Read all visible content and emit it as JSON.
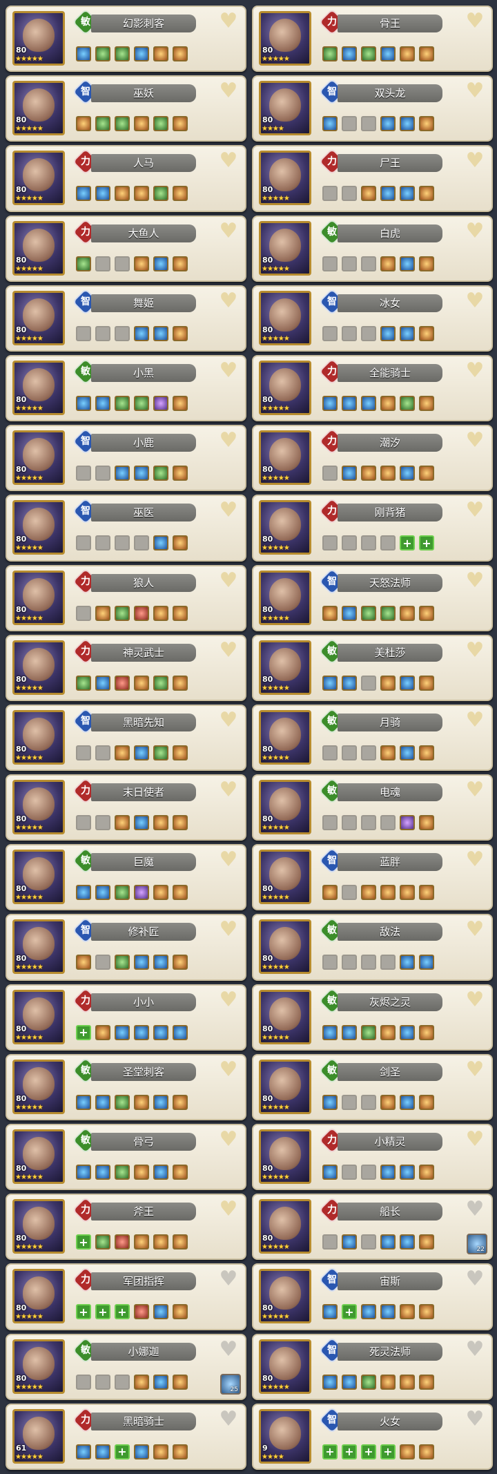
{
  "icons": {
    "heart": "heart-icon",
    "star": "star-icon",
    "item_slot": "item-slot-icon",
    "add": "plus-icon"
  },
  "colors": {
    "attr_strength": "#b02a2a",
    "attr_intelligence": "#2a57b0",
    "attr_agility": "#3c8d2a",
    "name_bar": "#7a7a76",
    "card_bg": "#f1ecde"
  },
  "heroes": [
    {
      "name": "幻影刺客",
      "attr": "敏",
      "level": "80",
      "stars": 5,
      "items": [
        "blue",
        "green",
        "green",
        "blue",
        "orange",
        "orange"
      ],
      "fav": "normal"
    },
    {
      "name": "骨王",
      "attr": "力",
      "level": "80",
      "stars": 5,
      "items": [
        "green",
        "blue",
        "green",
        "blue",
        "orange",
        "orange"
      ],
      "fav": "normal"
    },
    {
      "name": "巫妖",
      "attr": "智",
      "level": "80",
      "stars": 5,
      "items": [
        "orange",
        "green",
        "green",
        "orange",
        "green",
        "orange"
      ],
      "fav": "normal"
    },
    {
      "name": "双头龙",
      "attr": "智",
      "level": "80",
      "stars": 4,
      "items": [
        "blue",
        "empty",
        "empty",
        "blue",
        "blue",
        "orange"
      ],
      "fav": "normal"
    },
    {
      "name": "人马",
      "attr": "力",
      "level": "80",
      "stars": 5,
      "items": [
        "blue",
        "blue",
        "orange",
        "orange",
        "green",
        "orange"
      ],
      "fav": "normal"
    },
    {
      "name": "尸王",
      "attr": "力",
      "level": "80",
      "stars": 5,
      "items": [
        "empty",
        "empty",
        "orange",
        "blue",
        "blue",
        "orange"
      ],
      "fav": "normal"
    },
    {
      "name": "大鱼人",
      "attr": "力",
      "level": "80",
      "stars": 5,
      "items": [
        "green",
        "empty",
        "empty",
        "orange",
        "blue",
        "orange"
      ],
      "fav": "normal"
    },
    {
      "name": "白虎",
      "attr": "敏",
      "level": "80",
      "stars": 5,
      "items": [
        "empty",
        "empty",
        "empty",
        "orange",
        "blue",
        "orange"
      ],
      "fav": "normal"
    },
    {
      "name": "舞姬",
      "attr": "智",
      "level": "80",
      "stars": 5,
      "items": [
        "empty",
        "empty",
        "empty",
        "blue",
        "blue",
        "orange"
      ],
      "fav": "normal"
    },
    {
      "name": "冰女",
      "attr": "智",
      "level": "80",
      "stars": 5,
      "items": [
        "empty",
        "empty",
        "empty",
        "blue",
        "blue",
        "orange"
      ],
      "fav": "normal"
    },
    {
      "name": "小黑",
      "attr": "敏",
      "level": "80",
      "stars": 5,
      "items": [
        "blue",
        "blue",
        "green",
        "green",
        "purple",
        "orange"
      ],
      "fav": "normal"
    },
    {
      "name": "全能骑士",
      "attr": "力",
      "level": "80",
      "stars": 5,
      "items": [
        "blue",
        "blue",
        "blue",
        "orange",
        "green",
        "orange"
      ],
      "fav": "normal"
    },
    {
      "name": "小鹿",
      "attr": "智",
      "level": "80",
      "stars": 5,
      "items": [
        "empty",
        "empty",
        "blue",
        "blue",
        "green",
        "orange"
      ],
      "fav": "normal"
    },
    {
      "name": "潮汐",
      "attr": "力",
      "level": "80",
      "stars": 5,
      "items": [
        "empty",
        "blue",
        "orange",
        "orange",
        "blue",
        "orange"
      ],
      "fav": "normal"
    },
    {
      "name": "巫医",
      "attr": "智",
      "level": "80",
      "stars": 5,
      "items": [
        "empty",
        "empty",
        "empty",
        "empty",
        "blue",
        "orange"
      ],
      "fav": "normal"
    },
    {
      "name": "刚背猪",
      "attr": "力",
      "level": "80",
      "stars": 5,
      "items": [
        "empty",
        "empty",
        "empty",
        "empty",
        "plus",
        "plus"
      ],
      "fav": "normal"
    },
    {
      "name": "狼人",
      "attr": "力",
      "level": "80",
      "stars": 5,
      "items": [
        "empty",
        "orange",
        "green",
        "red",
        "orange",
        "orange"
      ],
      "fav": "normal"
    },
    {
      "name": "天怒法师",
      "attr": "智",
      "level": "80",
      "stars": 5,
      "items": [
        "orange",
        "blue",
        "green",
        "green",
        "orange",
        "orange"
      ],
      "fav": "normal"
    },
    {
      "name": "神灵武士",
      "attr": "力",
      "level": "80",
      "stars": 5,
      "items": [
        "green",
        "blue",
        "red",
        "orange",
        "green",
        "orange"
      ],
      "fav": "normal"
    },
    {
      "name": "美杜莎",
      "attr": "敏",
      "level": "80",
      "stars": 5,
      "items": [
        "blue",
        "blue",
        "empty",
        "orange",
        "blue",
        "orange"
      ],
      "fav": "normal"
    },
    {
      "name": "黑暗先知",
      "attr": "智",
      "level": "80",
      "stars": 5,
      "items": [
        "empty",
        "empty",
        "orange",
        "blue",
        "green",
        "orange"
      ],
      "fav": "normal"
    },
    {
      "name": "月骑",
      "attr": "敏",
      "level": "80",
      "stars": 5,
      "items": [
        "empty",
        "empty",
        "empty",
        "orange",
        "blue",
        "orange"
      ],
      "fav": "normal"
    },
    {
      "name": "末日使者",
      "attr": "力",
      "level": "80",
      "stars": 5,
      "items": [
        "empty",
        "empty",
        "orange",
        "blue",
        "orange",
        "orange"
      ],
      "fav": "normal"
    },
    {
      "name": "电魂",
      "attr": "敏",
      "level": "80",
      "stars": 5,
      "items": [
        "empty",
        "empty",
        "empty",
        "empty",
        "purple",
        "orange"
      ],
      "fav": "normal"
    },
    {
      "name": "巨魔",
      "attr": "敏",
      "level": "80",
      "stars": 5,
      "items": [
        "blue",
        "blue",
        "green",
        "purple",
        "orange",
        "orange"
      ],
      "fav": "normal"
    },
    {
      "name": "蓝胖",
      "attr": "智",
      "level": "80",
      "stars": 5,
      "items": [
        "orange",
        "empty",
        "orange",
        "orange",
        "orange",
        "orange"
      ],
      "fav": "normal"
    },
    {
      "name": "修补匠",
      "attr": "智",
      "level": "80",
      "stars": 5,
      "items": [
        "orange",
        "empty",
        "green",
        "blue",
        "blue",
        "orange"
      ],
      "fav": "normal"
    },
    {
      "name": "敌法",
      "attr": "敏",
      "level": "80",
      "stars": 5,
      "items": [
        "empty",
        "empty",
        "empty",
        "empty",
        "blue",
        "blue"
      ],
      "fav": "normal"
    },
    {
      "name": "小小",
      "attr": "力",
      "level": "80",
      "stars": 5,
      "items": [
        "plus",
        "orange",
        "blue",
        "blue",
        "blue",
        "blue"
      ],
      "fav": "normal"
    },
    {
      "name": "灰烬之灵",
      "attr": "敏",
      "level": "80",
      "stars": 5,
      "items": [
        "blue",
        "blue",
        "green",
        "orange",
        "blue",
        "orange"
      ],
      "fav": "normal"
    },
    {
      "name": "圣堂刺客",
      "attr": "敏",
      "level": "80",
      "stars": 5,
      "items": [
        "blue",
        "blue",
        "green",
        "orange",
        "blue",
        "orange"
      ],
      "fav": "normal"
    },
    {
      "name": "剑圣",
      "attr": "敏",
      "level": "80",
      "stars": 5,
      "items": [
        "blue",
        "empty",
        "empty",
        "orange",
        "blue",
        "orange"
      ],
      "fav": "normal"
    },
    {
      "name": "骨弓",
      "attr": "敏",
      "level": "80",
      "stars": 5,
      "items": [
        "blue",
        "blue",
        "green",
        "orange",
        "blue",
        "orange"
      ],
      "fav": "normal"
    },
    {
      "name": "小精灵",
      "attr": "力",
      "level": "80",
      "stars": 5,
      "items": [
        "blue",
        "empty",
        "empty",
        "blue",
        "blue",
        "orange"
      ],
      "fav": "normal"
    },
    {
      "name": "斧王",
      "attr": "力",
      "level": "80",
      "stars": 5,
      "items": [
        "plus",
        "green",
        "red",
        "orange",
        "orange",
        "orange"
      ],
      "fav": "normal"
    },
    {
      "name": "船长",
      "attr": "力",
      "level": "80",
      "stars": 5,
      "items": [
        "empty",
        "blue",
        "empty",
        "blue",
        "blue",
        "orange"
      ],
      "fav": "gray",
      "extra": "22"
    },
    {
      "name": "军团指挥",
      "attr": "力",
      "level": "80",
      "stars": 5,
      "items": [
        "plus",
        "plus",
        "plus",
        "red",
        "blue",
        "orange"
      ],
      "fav": "gray"
    },
    {
      "name": "宙斯",
      "attr": "智",
      "level": "80",
      "stars": 5,
      "items": [
        "blue",
        "plus",
        "blue",
        "blue",
        "orange",
        "orange"
      ],
      "fav": "gray"
    },
    {
      "name": "小娜迦",
      "attr": "敏",
      "level": "80",
      "stars": 5,
      "items": [
        "empty",
        "empty",
        "empty",
        "orange",
        "blue",
        "orange"
      ],
      "fav": "gray",
      "extra": "25"
    },
    {
      "name": "死灵法师",
      "attr": "智",
      "level": "80",
      "stars": 5,
      "items": [
        "blue",
        "blue",
        "green",
        "orange",
        "orange",
        "orange"
      ],
      "fav": "gray"
    },
    {
      "name": "黑暗骑士",
      "attr": "力",
      "level": "61",
      "stars": 5,
      "items": [
        "blue",
        "blue",
        "plus",
        "blue",
        "orange",
        "orange"
      ],
      "fav": "gray"
    },
    {
      "name": "火女",
      "attr": "智",
      "level": "9",
      "stars": 4,
      "items": [
        "plus",
        "plus",
        "plus",
        "plus",
        "orange",
        "orange"
      ],
      "fav": "gray"
    }
  ]
}
